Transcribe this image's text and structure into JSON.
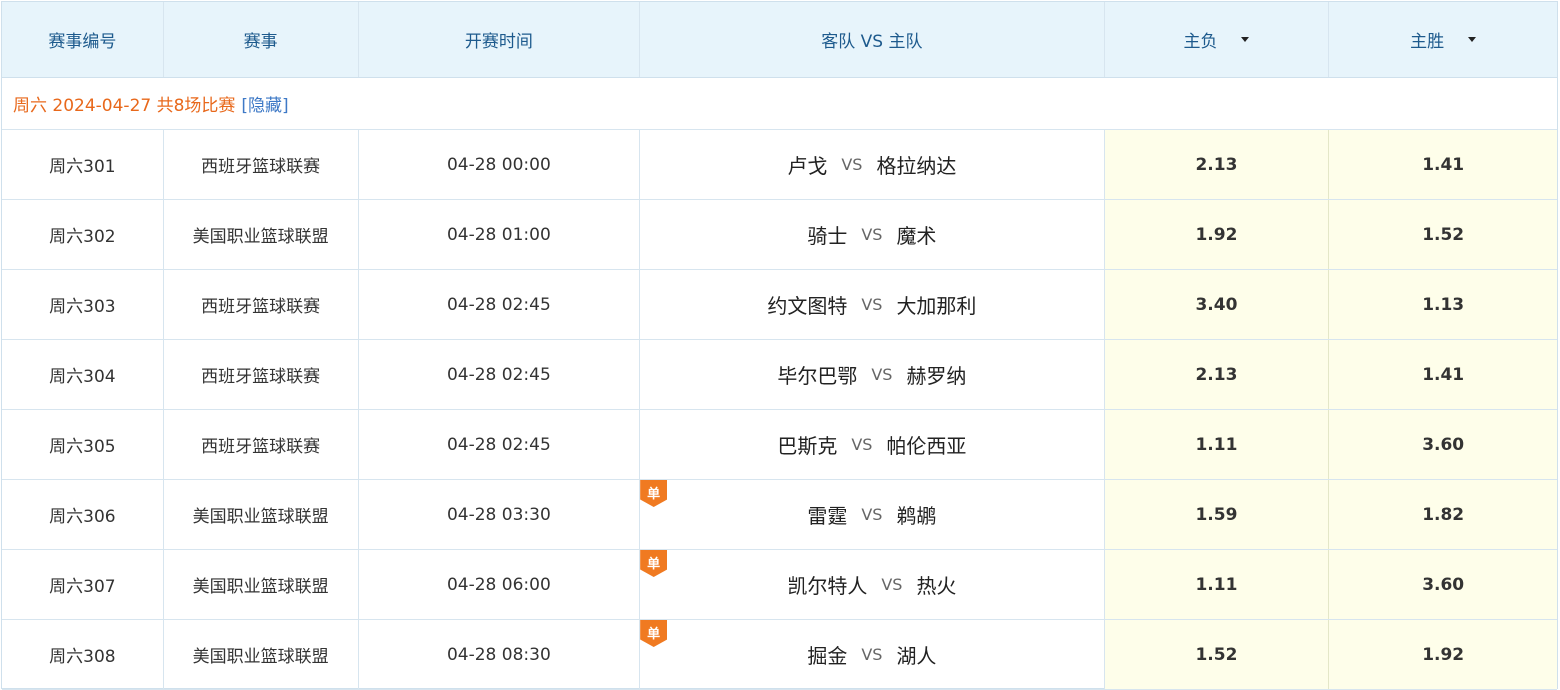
{
  "headers": {
    "id": "赛事编号",
    "league": "赛事",
    "time": "开赛时间",
    "teams": "客队 VS 主队",
    "away_win": "主负",
    "home_win": "主胜"
  },
  "group": {
    "label": "周六 2024-04-27 共8场比赛",
    "toggle": "[隐藏]"
  },
  "vs_text": "VS",
  "single_badge": "单",
  "matches": [
    {
      "id": "周六301",
      "league": "西班牙篮球联赛",
      "time": "04-28 00:00",
      "away": "卢戈",
      "home": "格拉纳达",
      "odds_lose": "2.13",
      "odds_win": "1.41",
      "single": false
    },
    {
      "id": "周六302",
      "league": "美国职业篮球联盟",
      "time": "04-28 01:00",
      "away": "骑士",
      "home": "魔术",
      "odds_lose": "1.92",
      "odds_win": "1.52",
      "single": false
    },
    {
      "id": "周六303",
      "league": "西班牙篮球联赛",
      "time": "04-28 02:45",
      "away": "约文图特",
      "home": "大加那利",
      "odds_lose": "3.40",
      "odds_win": "1.13",
      "single": false
    },
    {
      "id": "周六304",
      "league": "西班牙篮球联赛",
      "time": "04-28 02:45",
      "away": "毕尔巴鄂",
      "home": "赫罗纳",
      "odds_lose": "2.13",
      "odds_win": "1.41",
      "single": false
    },
    {
      "id": "周六305",
      "league": "西班牙篮球联赛",
      "time": "04-28 02:45",
      "away": "巴斯克",
      "home": "帕伦西亚",
      "odds_lose": "1.11",
      "odds_win": "3.60",
      "single": false
    },
    {
      "id": "周六306",
      "league": "美国职业篮球联盟",
      "time": "04-28 03:30",
      "away": "雷霆",
      "home": "鹈鹕",
      "odds_lose": "1.59",
      "odds_win": "1.82",
      "single": true
    },
    {
      "id": "周六307",
      "league": "美国职业篮球联盟",
      "time": "04-28 06:00",
      "away": "凯尔特人",
      "home": "热火",
      "odds_lose": "1.11",
      "odds_win": "3.60",
      "single": true
    },
    {
      "id": "周六308",
      "league": "美国职业篮球联盟",
      "time": "04-28 08:30",
      "away": "掘金",
      "home": "湖人",
      "odds_lose": "1.52",
      "odds_win": "1.92",
      "single": true
    }
  ]
}
